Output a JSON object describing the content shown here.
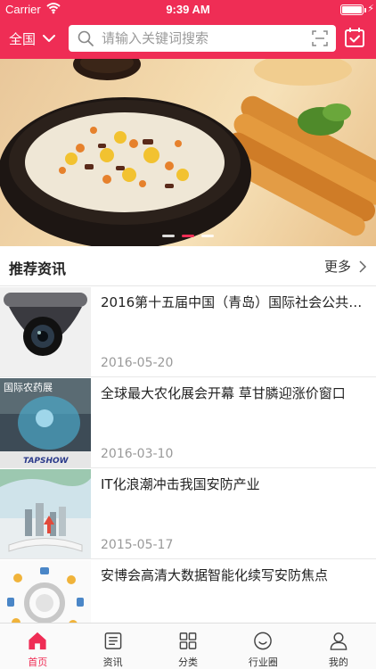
{
  "status_bar": {
    "carrier": "Carrier",
    "time": "9:39 AM"
  },
  "header": {
    "region": "全国",
    "search_placeholder": "请输入关键词搜索"
  },
  "banner": {
    "slide_count": 3,
    "active_slide": 2
  },
  "section": {
    "title": "推荐资讯",
    "more_label": "更多"
  },
  "news": [
    {
      "headline": "2016第十五届中国（青岛）国际社会公共安...",
      "date": "2016-05-20",
      "thumb": "security-camera"
    },
    {
      "headline": "全球最大农化展会开幕 草甘膦迎涨价窗口",
      "date": "2016-03-10",
      "thumb": "agrochemical-expo"
    },
    {
      "headline": "IT化浪潮冲击我国安防产业",
      "date": "2015-05-17",
      "thumb": "city-book-illustration"
    },
    {
      "headline": "安博会高清大数据智能化续写安防焦点",
      "date": "",
      "thumb": "tech-icons-circle"
    }
  ],
  "tabbar": [
    {
      "label": "首页",
      "icon": "home-icon",
      "active": true
    },
    {
      "label": "资讯",
      "icon": "news-icon",
      "active": false
    },
    {
      "label": "分类",
      "icon": "grid-icon",
      "active": false
    },
    {
      "label": "行业圈",
      "icon": "circle-icon",
      "active": false
    },
    {
      "label": "我的",
      "icon": "user-icon",
      "active": false
    }
  ],
  "colors": {
    "brand": "#ef2d55",
    "text": "#222222",
    "muted": "#999999"
  }
}
